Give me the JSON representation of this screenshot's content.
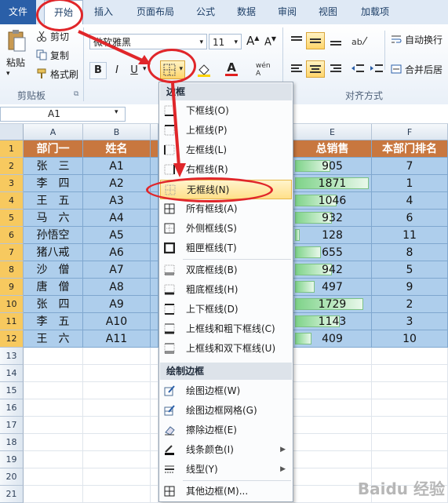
{
  "tabs": [
    "文件",
    "开始",
    "插入",
    "页面布局",
    "公式",
    "数据",
    "审阅",
    "视图",
    "加载项"
  ],
  "ribbon": {
    "clipboard": {
      "paste": "粘贴",
      "cut": "剪切",
      "copy": "复制",
      "format_painter": "格式刷",
      "group_label": "剪贴板"
    },
    "font": {
      "name": "微软雅黑",
      "size": "11",
      "bold": "B",
      "italic": "I",
      "underline": "U",
      "font_color_letter": "A"
    },
    "alignment": {
      "wrap_text": "自动换行",
      "merge_center": "合并后居",
      "group_label": "对齐方式"
    }
  },
  "formula_bar": {
    "name_box": "A1"
  },
  "sheet": {
    "columns": [
      "A",
      "B",
      "E",
      "F"
    ],
    "rows": [
      "1",
      "2",
      "3",
      "4",
      "5",
      "6",
      "7",
      "8",
      "9",
      "10",
      "11",
      "12",
      "13",
      "14",
      "15",
      "16",
      "17",
      "18",
      "19",
      "20",
      "21"
    ],
    "headers": [
      "部门一",
      "姓名",
      "总销售",
      "本部门排名"
    ],
    "data": [
      [
        "张　三",
        "A1",
        "905",
        "7"
      ],
      [
        "李　四",
        "A2",
        "1871",
        "1"
      ],
      [
        "王　五",
        "A3",
        "1046",
        "4"
      ],
      [
        "马　六",
        "A4",
        "932",
        "6"
      ],
      [
        "孙悟空",
        "A5",
        "128",
        "11"
      ],
      [
        "猪八戒",
        "A6",
        "655",
        "8"
      ],
      [
        "沙　僧",
        "A7",
        "942",
        "5"
      ],
      [
        "唐　僧",
        "A8",
        "497",
        "9"
      ],
      [
        "张　四",
        "A9",
        "1729",
        "2"
      ],
      [
        "李　五",
        "A10",
        "1143",
        "3"
      ],
      [
        "王　六",
        "A11",
        "409",
        "10"
      ]
    ]
  },
  "menu": {
    "section_borders": "边框",
    "section_draw": "绘制边框",
    "items": [
      "下框线(O)",
      "上框线(P)",
      "左框线(L)",
      "右框线(R)",
      "无框线(N)",
      "所有框线(A)",
      "外侧框线(S)",
      "粗匣框线(T)",
      "双底框线(B)",
      "粗底框线(H)",
      "上下框线(D)",
      "上框线和粗下框线(C)",
      "上框线和双下框线(U)"
    ],
    "draw_items": [
      "绘图边框(W)",
      "绘图边框网格(G)",
      "擦除边框(E)",
      "线条颜色(I)",
      "线型(Y)",
      "其他边框(M)..."
    ],
    "highlighted": "无框线(N)"
  },
  "colors": {
    "header_fill": "#c8773f",
    "data_fill": "#aeceec",
    "annotation": "#e0262a",
    "databar": "#7ed389"
  },
  "watermark": "Baidu 经验"
}
